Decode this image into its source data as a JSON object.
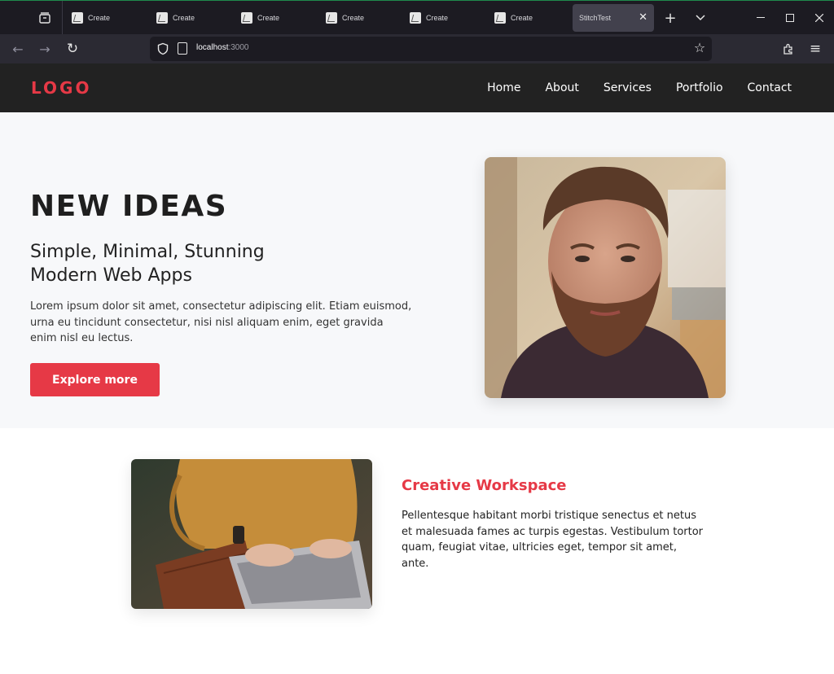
{
  "browser": {
    "tabs": [
      {
        "title": "Create"
      },
      {
        "title": "Create"
      },
      {
        "title": "Create"
      },
      {
        "title": "Create"
      },
      {
        "title": "Create"
      },
      {
        "title": "Create"
      }
    ],
    "active_tab": {
      "title": "StitchTest",
      "close": "✕"
    },
    "new_tab": "+",
    "tab_overflow": "⌄",
    "window": {
      "minimize": "—",
      "maximize": "☐",
      "close": "✕"
    },
    "nav": {
      "back": "←",
      "forward": "→",
      "reload": "↻"
    },
    "url": {
      "host": "localhost",
      "port": ":3000"
    },
    "bookmark": "☆",
    "extensions": "⧉",
    "menu": "≡"
  },
  "site": {
    "logo": "LOGO",
    "menu": [
      "Home",
      "About",
      "Services",
      "Portfolio",
      "Contact"
    ]
  },
  "hero": {
    "title": "NEW IDEAS",
    "subtitle_line1": "Simple, Minimal, Stunning",
    "subtitle_line2": "Modern Web Apps",
    "body": "Lorem ipsum dolor sit amet, consectetur adipiscing elit. Etiam euismod, urna eu tincidunt consectetur, nisi nisl aliquam enim, eget gravida enim nisl eu lectus.",
    "cta": "Explore more"
  },
  "feature": {
    "title": "Creative Workspace",
    "body": "Pellentesque habitant morbi tristique senectus et netus et malesuada fames ac turpis egestas. Vestibulum tortor quam, feugiat vitae, ultricies eget, tempor sit amet, ante."
  },
  "colors": {
    "accent": "#e63946",
    "header_bg": "#222222",
    "hero_bg": "#f7f8fa",
    "chrome_bg": "#1c1b22"
  }
}
